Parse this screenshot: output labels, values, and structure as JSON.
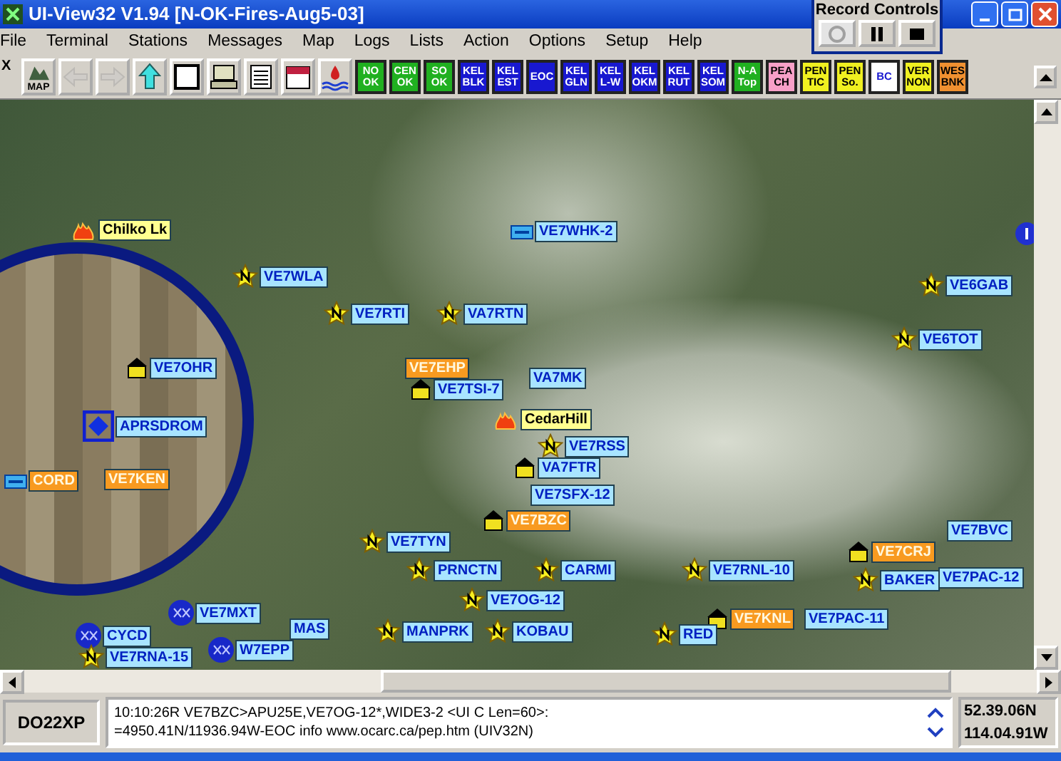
{
  "window": {
    "title": "UI-View32 V1.94 [N-OK-Fires-Aug5-03]"
  },
  "menu": [
    "File",
    "Terminal",
    "Stations",
    "Messages",
    "Map",
    "Logs",
    "Lists",
    "Action",
    "Options",
    "Setup",
    "Help"
  ],
  "record_controls": {
    "title": "Record Controls",
    "buttons": [
      {
        "kind": "record",
        "disabled": true
      },
      {
        "kind": "pause",
        "disabled": false
      },
      {
        "kind": "stop",
        "disabled": false
      }
    ]
  },
  "toolbar": {
    "close": "X",
    "icon_buttons": [
      {
        "kind": "map",
        "label": "MAP",
        "disabled": false
      },
      {
        "kind": "back",
        "disabled": true
      },
      {
        "kind": "forward",
        "disabled": true
      },
      {
        "kind": "up",
        "disabled": false
      },
      {
        "kind": "window",
        "disabled": false
      },
      {
        "kind": "computer",
        "disabled": false
      },
      {
        "kind": "list",
        "disabled": false
      },
      {
        "kind": "calendar",
        "disabled": false
      },
      {
        "kind": "weather",
        "disabled": false
      }
    ],
    "text_buttons": [
      {
        "lines": [
          "NO",
          "OK"
        ],
        "color": "#20b020"
      },
      {
        "lines": [
          "CEN",
          "OK"
        ],
        "color": "#20b020"
      },
      {
        "lines": [
          "SO",
          "OK"
        ],
        "color": "#20b020"
      },
      {
        "lines": [
          "KEL",
          "BLK"
        ],
        "color": "#1818d0"
      },
      {
        "lines": [
          "KEL",
          "EST"
        ],
        "color": "#1818d0"
      },
      {
        "lines": [
          "EOC"
        ],
        "color": "#1818d0"
      },
      {
        "lines": [
          "KEL",
          "GLN"
        ],
        "color": "#1818d0"
      },
      {
        "lines": [
          "KEL",
          "L-W"
        ],
        "color": "#1818d0"
      },
      {
        "lines": [
          "KEL",
          "OKM"
        ],
        "color": "#1818d0"
      },
      {
        "lines": [
          "KEL",
          "RUT"
        ],
        "color": "#1818d0"
      },
      {
        "lines": [
          "KEL",
          "SOM"
        ],
        "color": "#1818d0"
      },
      {
        "lines": [
          "N-A",
          "Top"
        ],
        "color": "#20b020"
      },
      {
        "lines": [
          "PEA",
          "CH"
        ],
        "color": "#f8a0c8"
      },
      {
        "lines": [
          "PEN",
          "TIC"
        ],
        "color": "#f0f020"
      },
      {
        "lines": [
          "PEN",
          "So."
        ],
        "color": "#f0f020"
      },
      {
        "lines": [
          "BC"
        ],
        "color": "#ffffff"
      },
      {
        "lines": [
          "VER",
          "NON"
        ],
        "color": "#f0f020"
      },
      {
        "lines": [
          "WES",
          "BNK"
        ],
        "color": "#f09030"
      }
    ]
  },
  "map": {
    "stations": [
      {
        "kind": "fire",
        "label": "Chilko Lk",
        "color": "#ffff90"
      },
      {
        "kind": "eoc",
        "label": "VE7WHK-2",
        "color": "#a8e4ff"
      },
      {
        "kind": "star",
        "label": "VE7WLA",
        "color": "#a8e4ff"
      },
      {
        "kind": "star",
        "label": "VE6GAB",
        "color": "#a8e4ff"
      },
      {
        "kind": "star",
        "label": "VE7RTI",
        "color": "#a8e4ff"
      },
      {
        "kind": "star",
        "label": "VA7RTN",
        "color": "#a8e4ff"
      },
      {
        "kind": "star",
        "label": "VE6TOT",
        "color": "#a8e4ff"
      },
      {
        "kind": "house",
        "label": "VE7OHR",
        "color": "#a8e4ff"
      },
      {
        "kind": "none",
        "label": "VE7EHP",
        "color": "#f89a20"
      },
      {
        "kind": "none",
        "label": "VA7MK",
        "color": "#a8e4ff"
      },
      {
        "kind": "house",
        "label": "VE7TSI-7",
        "color": "#a8e4ff"
      },
      {
        "kind": "diamond",
        "label": "APRSDROM",
        "color": "#a8e4ff"
      },
      {
        "kind": "fire",
        "label": "CedarHill",
        "color": "#ffff90"
      },
      {
        "kind": "star",
        "label": "VE7RSS",
        "color": "#a8e4ff"
      },
      {
        "kind": "house",
        "label": "VA7FTR",
        "color": "#a8e4ff"
      },
      {
        "kind": "eoc",
        "label": "CORD",
        "color": "#f89a20"
      },
      {
        "kind": "none",
        "label": "VE7KEN",
        "color": "#f89a20"
      },
      {
        "kind": "none",
        "label": "VE7SFX-12",
        "color": "#a8e4ff"
      },
      {
        "kind": "house",
        "label": "VE7BZC",
        "color": "#f89a20"
      },
      {
        "kind": "none",
        "label": "VE7BVC",
        "color": "#a8e4ff"
      },
      {
        "kind": "star",
        "label": "VE7TYN",
        "color": "#a8e4ff"
      },
      {
        "kind": "house",
        "label": "VE7CRJ",
        "color": "#f89a20"
      },
      {
        "kind": "star",
        "label": "PRNCTN",
        "color": "#a8e4ff"
      },
      {
        "kind": "star",
        "label": "CARMI",
        "color": "#a8e4ff"
      },
      {
        "kind": "star",
        "label": "VE7RNL-10",
        "color": "#a8e4ff"
      },
      {
        "kind": "star",
        "label": "BAKER",
        "color": "#a8e4ff"
      },
      {
        "kind": "none",
        "label": "VE7PAC-12",
        "color": "#a8e4ff"
      },
      {
        "kind": "star",
        "label": "VE7OG-12",
        "color": "#a8e4ff"
      },
      {
        "kind": "wx",
        "label": "VE7MXT",
        "color": "#a8e4ff"
      },
      {
        "kind": "house",
        "label": "VE7KNL",
        "color": "#f89a20"
      },
      {
        "kind": "none",
        "label": "VE7PAC-11",
        "color": "#a8e4ff"
      },
      {
        "kind": "wx",
        "label": "CYCD",
        "color": "#a8e4ff"
      },
      {
        "kind": "none",
        "label": "MAS",
        "color": "#a8e4ff"
      },
      {
        "kind": "star",
        "label": "MANPRK",
        "color": "#a8e4ff"
      },
      {
        "kind": "star",
        "label": "KOBAU",
        "color": "#a8e4ff"
      },
      {
        "kind": "star",
        "label": "RED",
        "color": "#a8e4ff"
      },
      {
        "kind": "wx",
        "label": "W7EPP",
        "color": "#a8e4ff"
      },
      {
        "kind": "star",
        "label": "VE7RNA-15",
        "color": "#a8e4ff"
      }
    ]
  },
  "status": {
    "locator": "DO22XP",
    "message": [
      "10:10:26R VE7BZC>APU25E,VE7OG-12*,WIDE3-2 <UI C Len=60>:",
      "=4950.41N/11936.94W-EOC info  www.ocarc.ca/pep.htm (UIV32N)"
    ],
    "latitude": "52.39.06N",
    "longitude": "114.04.91W"
  }
}
